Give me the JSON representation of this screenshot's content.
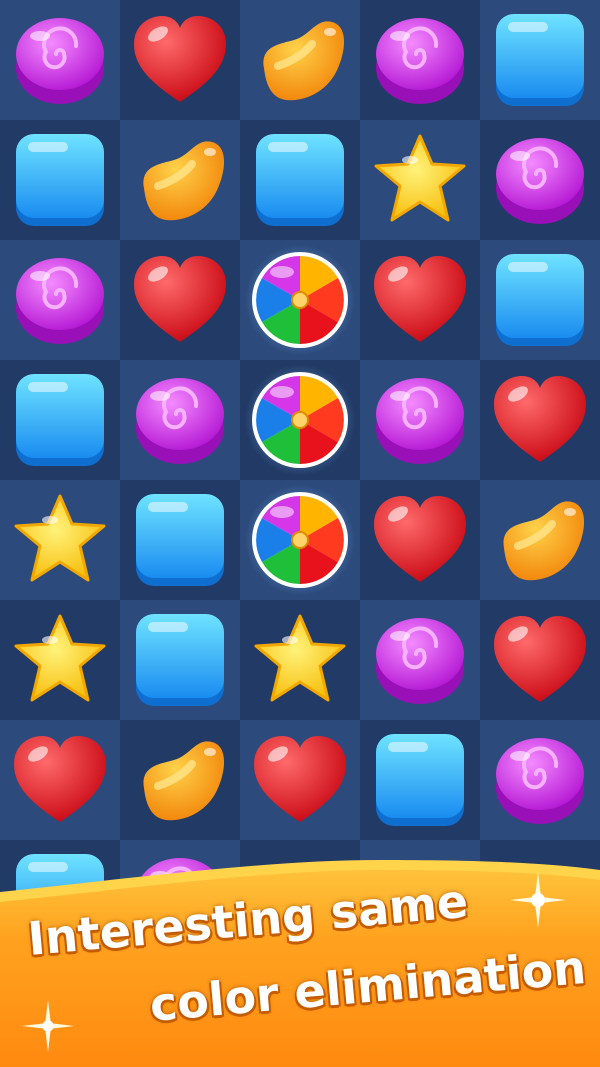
{
  "tagline": {
    "line1": "Interesting same",
    "line2": "color elimination"
  },
  "board": {
    "columns": 5,
    "rows": [
      [
        "purple-swirl-candy",
        "red-heart-candy",
        "orange-bean-candy",
        "purple-swirl-candy",
        "blue-square-candy"
      ],
      [
        "blue-square-candy",
        "orange-bean-candy",
        "blue-square-candy",
        "yellow-star-candy",
        "purple-swirl-candy"
      ],
      [
        "purple-swirl-candy",
        "red-heart-candy",
        "rainbow-ball-candy",
        "red-heart-candy",
        "blue-square-candy"
      ],
      [
        "blue-square-candy",
        "purple-swirl-candy",
        "rainbow-ball-candy",
        "purple-swirl-candy",
        "red-heart-candy"
      ],
      [
        "yellow-star-candy",
        "blue-square-candy",
        "rainbow-ball-candy",
        "red-heart-candy",
        "orange-bean-candy"
      ],
      [
        "yellow-star-candy",
        "blue-square-candy",
        "yellow-star-candy",
        "purple-swirl-candy",
        "red-heart-candy"
      ],
      [
        "red-heart-candy",
        "orange-bean-candy",
        "red-heart-candy",
        "blue-square-candy",
        "purple-swirl-candy"
      ],
      [
        "blue-square-candy",
        "purple-swirl-candy",
        "",
        "",
        ""
      ]
    ],
    "highlighted_cells": [
      [
        2,
        2
      ],
      [
        3,
        2
      ],
      [
        4,
        2
      ]
    ]
  },
  "colors": {
    "board_dark": "#223a66",
    "board_light": "#2c4a7c",
    "banner_orange": "#ffa21f",
    "banner_edge": "#ffd34a",
    "text": "#ffffff",
    "text_shadow": "#c45c00"
  }
}
